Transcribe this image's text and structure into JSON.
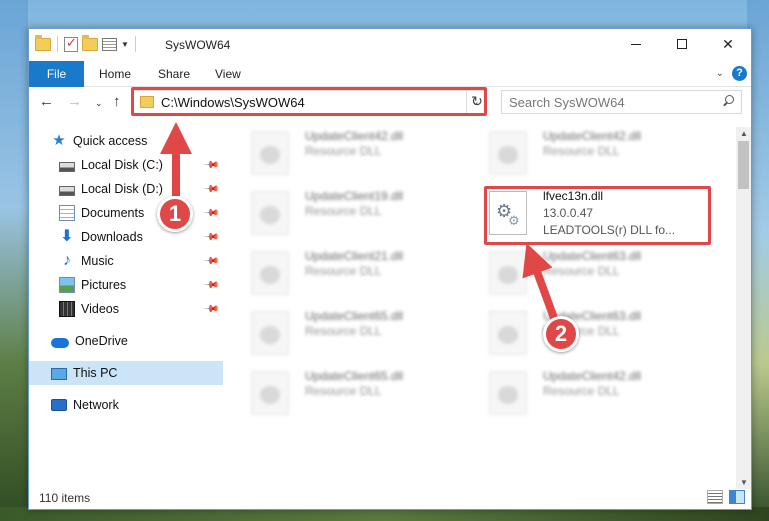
{
  "window": {
    "title": "SysWOW64",
    "min_glyph": "",
    "close_glyph": "✕"
  },
  "ribbon": {
    "tabs": [
      "File",
      "Home",
      "Share",
      "View"
    ],
    "help": "?"
  },
  "address": {
    "path": "C:\\Windows\\SysWOW64",
    "search_placeholder": "Search SysWOW64"
  },
  "sidebar": {
    "items": [
      {
        "label": "Quick access",
        "icon": "star-icon",
        "pinned": false
      },
      {
        "label": "Local Disk (C:)",
        "icon": "disk-icon",
        "pinned": true
      },
      {
        "label": "Local Disk (D:)",
        "icon": "disk-icon",
        "pinned": true
      },
      {
        "label": "Documents",
        "icon": "documents-icon",
        "pinned": true
      },
      {
        "label": "Downloads",
        "icon": "downloads-icon",
        "pinned": true
      },
      {
        "label": "Music",
        "icon": "music-icon",
        "pinned": true
      },
      {
        "label": "Pictures",
        "icon": "pictures-icon",
        "pinned": true
      },
      {
        "label": "Videos",
        "icon": "videos-icon",
        "pinned": true
      },
      {
        "label": "OneDrive",
        "icon": "onedrive-icon",
        "pinned": false
      },
      {
        "label": "This PC",
        "icon": "this-pc-icon",
        "pinned": false,
        "selected": true
      },
      {
        "label": "Network",
        "icon": "network-icon",
        "pinned": false
      }
    ]
  },
  "files": [
    {
      "name": "UpdateClient42.dll",
      "desc": "Resource DLL"
    },
    {
      "name": "UpdateClient42.dll",
      "desc": "Resource DLL"
    },
    {
      "name": "UpdateClient19.dll",
      "desc": "Resource DLL"
    },
    {
      "name": "lfvec13n.dll",
      "version": "13.0.0.47",
      "desc": "LEADTOOLS(r) DLL fo..."
    },
    {
      "name": "UpdateClient21.dll",
      "desc": "Resource DLL"
    },
    {
      "name": "UpdateClient63.dll",
      "desc": "Resource DLL"
    },
    {
      "name": "UpdateClient65.dll",
      "desc": "Resource DLL"
    },
    {
      "name": "UpdateClient63.dll",
      "desc": "Resource DLL"
    },
    {
      "name": "UpdateClient65.dll",
      "desc": "Resource DLL"
    },
    {
      "name": "UpdateClient42.dll",
      "desc": "Resource DLL"
    }
  ],
  "status": {
    "item_count": "110 items"
  },
  "annotations": {
    "step1": "1",
    "step2": "2",
    "color": "#e04848"
  }
}
